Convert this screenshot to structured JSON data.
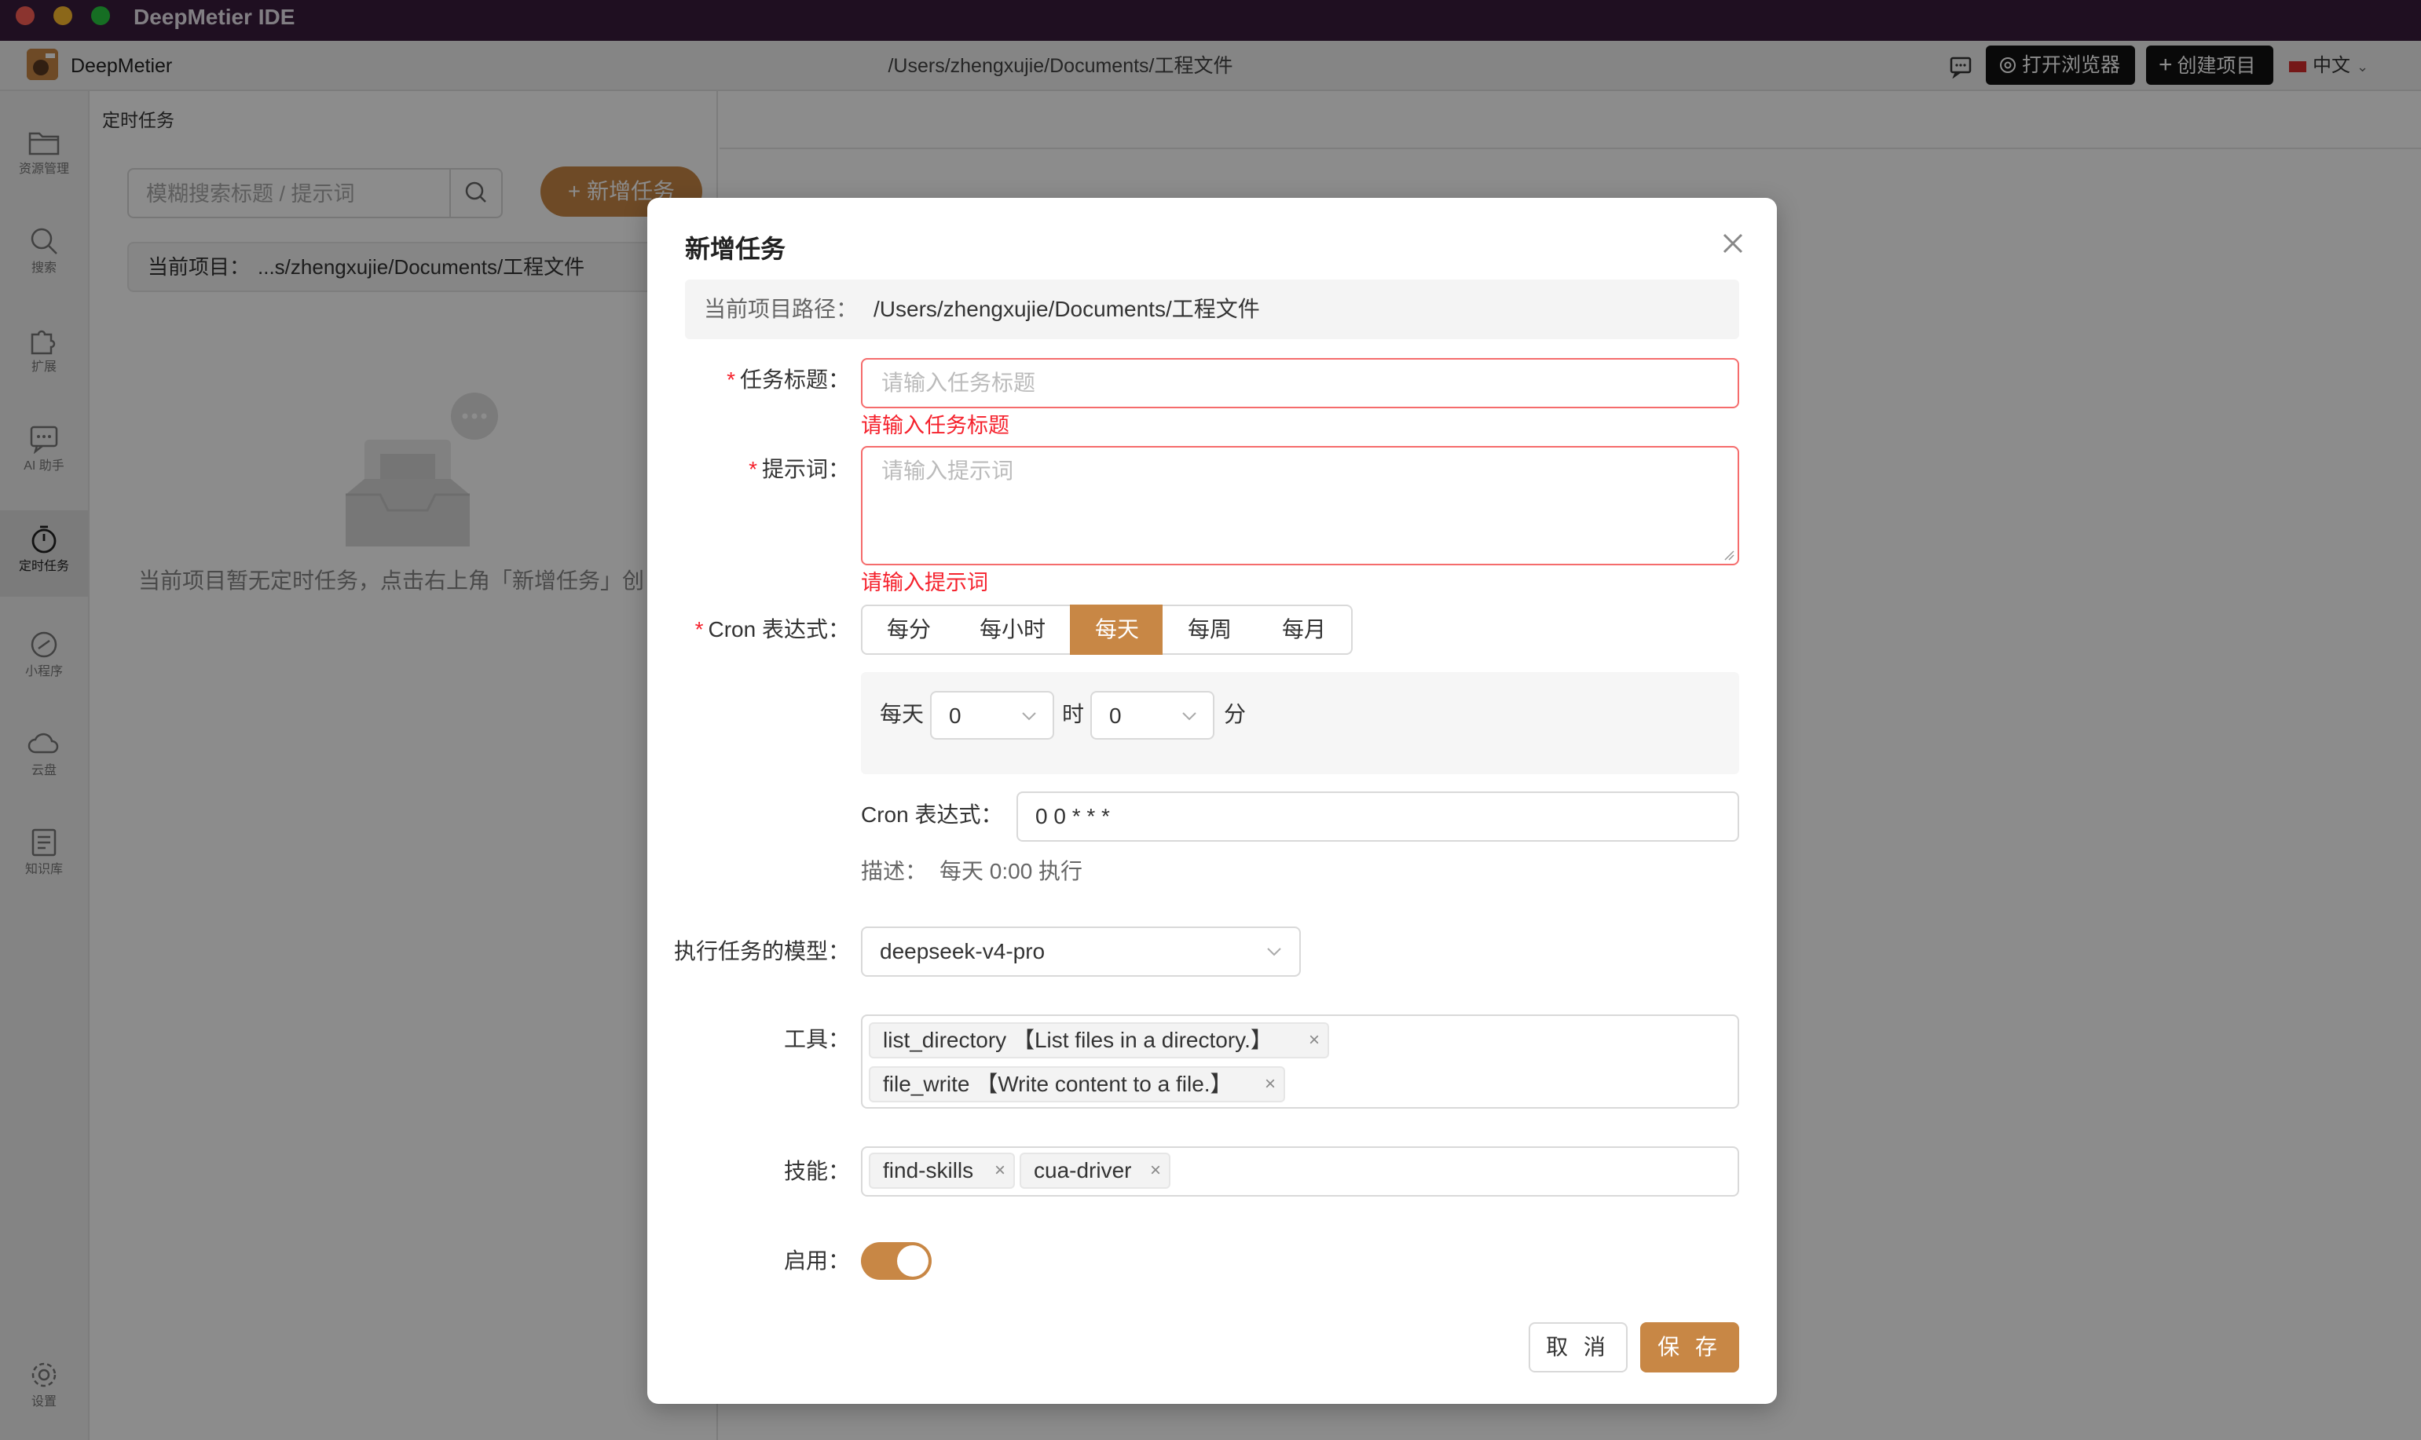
{
  "window": {
    "title": "DeepMetier IDE"
  },
  "header": {
    "brand": "DeepMetier",
    "path": "/Users/zhengxujie/Documents/工程文件",
    "open_browser": "打开浏览器",
    "create_project": "创建项目",
    "language": "中文"
  },
  "sidebar": {
    "items": [
      {
        "label": "资源管理",
        "icon": "folder-icon"
      },
      {
        "label": "搜索",
        "icon": "search-icon"
      },
      {
        "label": "扩展",
        "icon": "puzzle-icon"
      },
      {
        "label": "AI 助手",
        "icon": "chat-icon"
      },
      {
        "label": "定时任务",
        "icon": "timer-icon"
      },
      {
        "label": "小程序",
        "icon": "link-icon"
      },
      {
        "label": "云盘",
        "icon": "cloud-icon"
      },
      {
        "label": "知识库",
        "icon": "book-icon"
      },
      {
        "label": "设置",
        "icon": "gear-icon"
      }
    ]
  },
  "panel": {
    "title": "定时任务",
    "search_placeholder": "模糊搜索标题 / 提示词",
    "new_task": "+ 新增任务",
    "current_project_label": "当前项目：",
    "current_project_value": "...s/zhengxujie/Documents/工程文件",
    "empty_text": "当前项目暂无定时任务，点击右上角「新增任务」创"
  },
  "modal": {
    "title": "新增任务",
    "path_label": "当前项目路径：",
    "path_value": "/Users/zhengxujie/Documents/工程文件",
    "task_title_label": "任务标题：",
    "task_title_placeholder": "请输入任务标题",
    "task_title_error": "请输入任务标题",
    "prompt_label": "提示词：",
    "prompt_placeholder": "请输入提示词",
    "prompt_error": "请输入提示词",
    "cron_label": "Cron 表达式：",
    "cron_options": [
      "每分",
      "每小时",
      "每天",
      "每周",
      "每月"
    ],
    "cron_selected": "每天",
    "daily_prefix": "每天",
    "hour_value": "0",
    "hour_unit": "时",
    "minute_value": "0",
    "minute_unit": "分",
    "cron_expr_label": "Cron 表达式：",
    "cron_expr_value": "0 0 * * *",
    "desc_label": "描述：",
    "desc_value": "每天 0:00 执行",
    "model_label": "执行任务的模型：",
    "model_value": "deepseek-v4-pro",
    "tools_label": "工具：",
    "tools": [
      "list_directory 【List files in a directory.】",
      "file_write 【Write content to a file.】"
    ],
    "skills_label": "技能：",
    "skills": [
      "find-skills",
      "cua-driver"
    ],
    "enable_label": "启用：",
    "enabled": true,
    "cancel": "取 消",
    "save": "保 存"
  },
  "colors": {
    "accent": "#c88745",
    "error": "#f5222d",
    "titlebar": "#3a1d3d"
  }
}
